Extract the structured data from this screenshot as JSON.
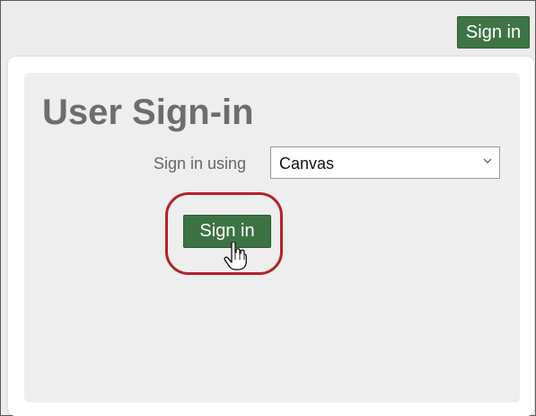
{
  "header": {
    "signin_label": "Sign in"
  },
  "dialog": {
    "title": "User Sign-in",
    "signin_using_label": "Sign in using",
    "provider": {
      "selected": "Canvas"
    },
    "signin_button_label": "Sign in"
  },
  "icons": {
    "dropdown": "chevron-down-icon",
    "cursor": "hand-cursor-icon"
  },
  "colors": {
    "button_green": "#3d7344",
    "highlight_red": "#b3222c",
    "title_gray": "#6d6d6d"
  }
}
